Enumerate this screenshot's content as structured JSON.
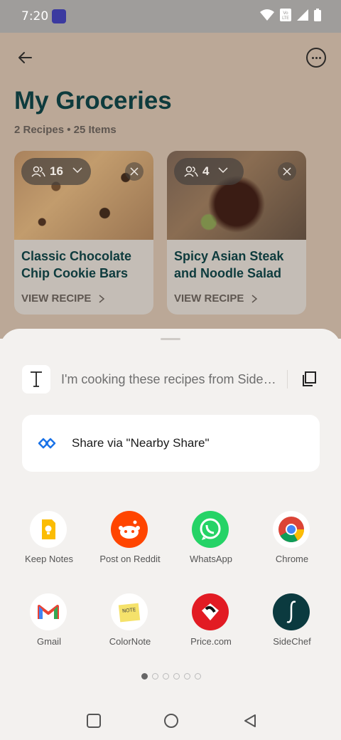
{
  "status_bar": {
    "time": "7:20"
  },
  "page": {
    "title": "My Groceries",
    "subtitle": "2 Recipes • 25 Items",
    "cards": [
      {
        "servings": "16",
        "title": "Classic Chocolate Chip Cookie Bars",
        "link": "VIEW RECIPE"
      },
      {
        "servings": "4",
        "title": "Spicy Asian Steak and Noodle Salad",
        "link": "VIEW RECIPE"
      }
    ]
  },
  "share_sheet": {
    "preview_text": "I'm cooking these recipes from SideC...",
    "nearby_label": "Share via \"Nearby Share\"",
    "apps": [
      {
        "label": "Keep Notes",
        "icon": "keep-notes-icon"
      },
      {
        "label": "Post on Reddit",
        "icon": "reddit-icon"
      },
      {
        "label": "WhatsApp",
        "icon": "whatsapp-icon"
      },
      {
        "label": "Chrome",
        "icon": "chrome-icon"
      },
      {
        "label": "Gmail",
        "icon": "gmail-icon"
      },
      {
        "label": "ColorNote",
        "icon": "colornote-icon"
      },
      {
        "label": "Price.com",
        "icon": "price-com-icon"
      },
      {
        "label": "SideChef",
        "icon": "sidechef-icon"
      }
    ],
    "page_dots": {
      "count": 6,
      "active": 1
    }
  },
  "colors": {
    "title": "#0e3b3d",
    "reddit": "#ff4500",
    "whatsapp": "#25d366",
    "nearby_share": "#1a73e8"
  }
}
